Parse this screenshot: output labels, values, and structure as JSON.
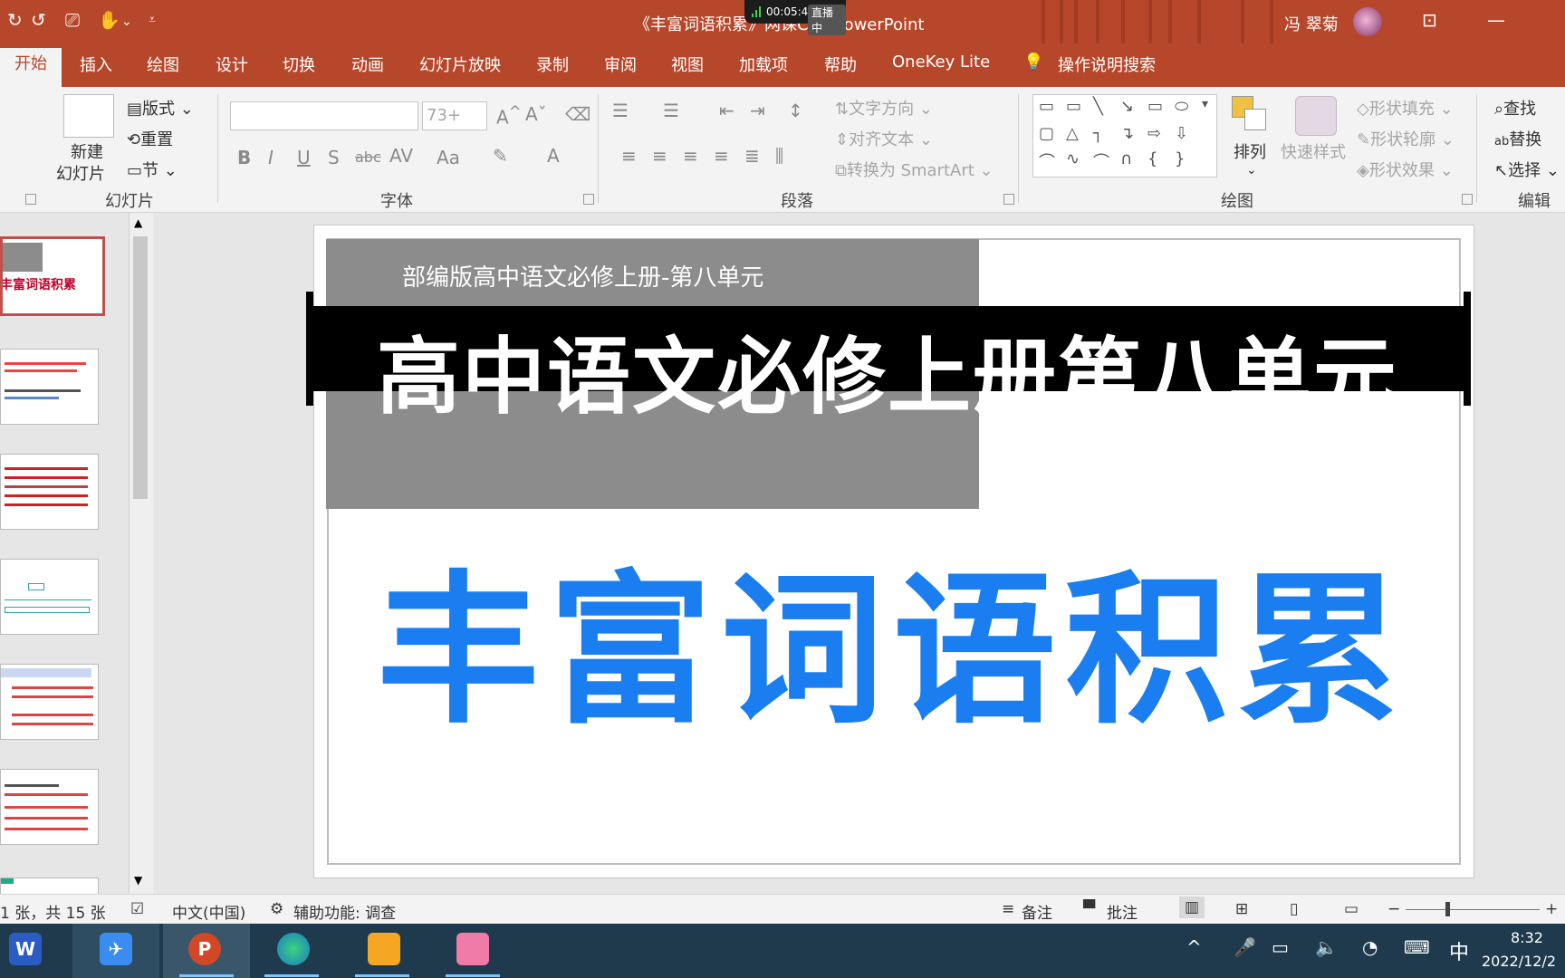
{
  "titlebar": {
    "doc_title": "《丰富词语积累》网课CP - PowerPoint",
    "recording_time": "00:05:44",
    "recording_status": "直播中",
    "user_name": "冯 翠菊"
  },
  "tabs": [
    "开始",
    "插入",
    "绘图",
    "设计",
    "切换",
    "动画",
    "幻灯片放映",
    "录制",
    "审阅",
    "视图",
    "加载项",
    "帮助",
    "OneKey Lite"
  ],
  "tell_me": "操作说明搜索",
  "ribbon": {
    "slides": {
      "new_slide_line1": "新建",
      "new_slide_line2": "幻灯片",
      "layout": "版式",
      "reset": "重置",
      "section": "节",
      "group_label": "幻灯片"
    },
    "font": {
      "size_value": "73+",
      "group_label": "字体"
    },
    "paragraph": {
      "text_direction": "文字方向",
      "align_text": "对齐文本",
      "convert_smartart": "转换为 SmartArt",
      "group_label": "段落"
    },
    "drawing": {
      "arrange": "排列",
      "quick_styles": "快速样式",
      "shape_fill": "形状填充",
      "shape_outline": "形状轮廓",
      "shape_effects": "形状效果",
      "group_label": "绘图"
    },
    "editing": {
      "find": "查找",
      "replace": "替换",
      "select": "选择",
      "group_label": "编辑"
    }
  },
  "thumbnails": {
    "slide1_title": "丰富词语积累"
  },
  "slide": {
    "subtitle": "部编版高中语文必修上册-第八单元",
    "banner": "高中语文必修上册第八单元",
    "title": "丰富词语积累",
    "title_color": "#1a7ef0"
  },
  "statusbar": {
    "slide_count": "1 张，共 15 张",
    "language": "中文(中国)",
    "accessibility": "辅助功能: 调查",
    "notes": "备注",
    "comments": "批注"
  },
  "taskbar": {
    "ime": "中",
    "time": "8:32",
    "date": "2022/12/2"
  }
}
